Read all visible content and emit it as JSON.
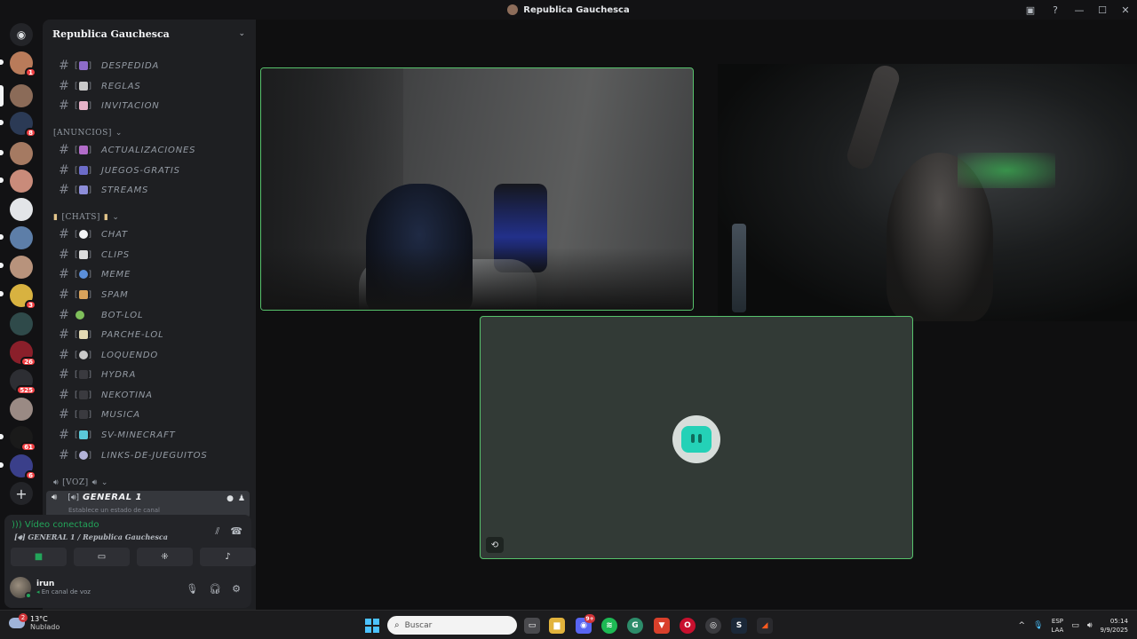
{
  "window": {
    "title": "Republica Gauchesca"
  },
  "server": {
    "name": "Republica Gauchesca"
  },
  "channels_top": [
    {
      "name": "DESPEDIDA"
    },
    {
      "name": "REGLAS"
    },
    {
      "name": "INVITACION"
    }
  ],
  "categories": {
    "anuncios": "[ANUNCIOS]",
    "chats": "[CHATS]",
    "voz": "[VOZ]"
  },
  "channels_anuncios": [
    {
      "name": "ACTUALIZACIONES"
    },
    {
      "name": "JUEGOS-GRATIS"
    },
    {
      "name": "STREAMS"
    }
  ],
  "channels_chats": [
    {
      "name": "CHAT"
    },
    {
      "name": "CLIPS"
    },
    {
      "name": "MEME"
    },
    {
      "name": "SPAM"
    },
    {
      "name": "BOT-LOL"
    },
    {
      "name": "PARCHE-LOL"
    },
    {
      "name": "LOQUENDO"
    },
    {
      "name": "HYDRA"
    },
    {
      "name": "NEKOTINA"
    },
    {
      "name": "MUSICA"
    },
    {
      "name": "SV-MINECRAFT"
    },
    {
      "name": "LINKS-DE-JUEGUITOS"
    }
  ],
  "voice_channel": {
    "name": "GENERAL 1",
    "status_hint": "Establece un estado de canal"
  },
  "voice_panel": {
    "status": "Vídeo conectado",
    "channel": "GENERAL 1 / Republica Gauchesca"
  },
  "user": {
    "name": "irun",
    "status": "En canal de voz"
  },
  "server_badges": [
    "1",
    "8",
    "3",
    "26",
    "525",
    "61",
    "6"
  ],
  "colors": {
    "accent_green": "#23a55a",
    "tile_border": "#57c26c",
    "badge_red": "#f23f43",
    "bg_dark": "#121214"
  },
  "taskbar": {
    "weather_temp": "13°C",
    "weather_desc": "Nublado",
    "weather_badge": "2",
    "search_placeholder": "Buscar",
    "discord_badge": "9+",
    "lang_1": "ESP",
    "lang_2": "LAA",
    "time": "05:14",
    "date": "9/9/2025"
  }
}
